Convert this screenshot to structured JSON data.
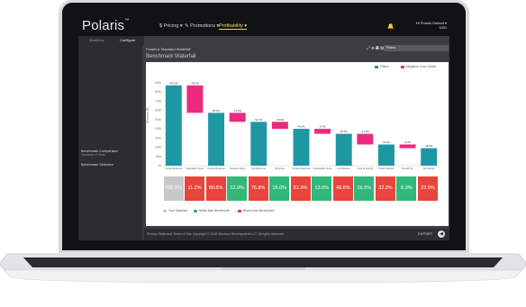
{
  "app": {
    "logo": "Polaris",
    "trademark": "™",
    "nav": [
      {
        "label": "$ Pricing ▾",
        "active": false
      },
      {
        "label": "✎ Promotions ▾",
        "active": false
      },
      {
        "label": "Profitability ▾",
        "active": true
      }
    ],
    "user": {
      "line1": "Hi Polaris Default ▾",
      "line2": "USD"
    },
    "bell_icon": "bell-icon"
  },
  "sidebar": {
    "tabs": [
      {
        "label": "Workflow",
        "active": false
      },
      {
        "label": "Configure",
        "active": true
      }
    ],
    "items": [
      {
        "label": "Benchmark Comparison",
        "sub": "Customer of Store"
      },
      {
        "label": "Benchmark Selection",
        "sub": ""
      }
    ]
  },
  "main": {
    "breadcrumb": "Polaris ▸ Standard Waterfall",
    "tools": "⤢ ⊕ ▦ ✪",
    "filter": "Filters",
    "panel_title": "Benchmark Waterfall"
  },
  "chart_data": {
    "type": "bar",
    "title": "",
    "legend": [
      {
        "label": "Filters",
        "color": "#1e97a3"
      },
      {
        "label": "Negative Cost Center",
        "color": "#ea2b80"
      }
    ],
    "ylabel": "Revenue ($)",
    "yticks": [
      "900k",
      "800k",
      "700k",
      "600k",
      "500k",
      "400k",
      "300k",
      "200k",
      "100k",
      "0k"
    ],
    "ylim": [
      0,
      900
    ],
    "categories": [
      "Gross Revenue",
      "Negotiable Items",
      "Invoice Revenue",
      "Invoiced Items",
      "Net Revenue",
      "Bonuses",
      "Pocket Revenue",
      "Chargeable Items",
      "Contribution",
      "Cost of Goods",
      "Pocket Margin",
      "Overall Inc.",
      "Net Margin"
    ],
    "bars": [
      {
        "kind": "total",
        "start": 0,
        "end": 872,
        "label": "100.0%"
      },
      {
        "kind": "decrease",
        "start": 872,
        "end": 574,
        "label": "-34.2%"
      },
      {
        "kind": "total",
        "start": 0,
        "end": 574,
        "label": "65.8%"
      },
      {
        "kind": "decrease",
        "start": 574,
        "end": 476,
        "label": "-12.0%"
      },
      {
        "kind": "total",
        "start": 0,
        "end": 476,
        "label": "54.7%"
      },
      {
        "kind": "decrease",
        "start": 476,
        "end": 400,
        "label": "-15.0%"
      },
      {
        "kind": "total",
        "start": 0,
        "end": 400,
        "label": "46.0%"
      },
      {
        "kind": "decrease",
        "start": 400,
        "end": 346,
        "label": "-8.0%"
      },
      {
        "kind": "total",
        "start": 0,
        "end": 346,
        "label": "36.8%"
      },
      {
        "kind": "decrease",
        "start": 346,
        "end": 230,
        "label": "-17.0%"
      },
      {
        "kind": "total",
        "start": 0,
        "end": 230,
        "label": "23.0%"
      },
      {
        "kind": "decrease",
        "start": 230,
        "end": 190,
        "label": "-6.2%"
      },
      {
        "kind": "total",
        "start": 0,
        "end": 190,
        "label": "18.0%"
      }
    ]
  },
  "tiles": [
    {
      "label": "100.0%",
      "color": "#c8c8c8"
    },
    {
      "label": "11.2%",
      "color": "#e8453c"
    },
    {
      "label": "88.8%",
      "color": "#e8453c"
    },
    {
      "label": "12.0%",
      "color": "#33b77a"
    },
    {
      "label": "76.8%",
      "color": "#e8453c"
    },
    {
      "label": "15.0%",
      "color": "#33b77a"
    },
    {
      "label": "61.8%",
      "color": "#e8453c"
    },
    {
      "label": "13.0%",
      "color": "#33b77a"
    },
    {
      "label": "48.8%",
      "color": "#e8453c"
    },
    {
      "label": "16.5%",
      "color": "#33b77a"
    },
    {
      "label": "32.3%",
      "color": "#e8453c"
    },
    {
      "label": "8.3%",
      "color": "#33b77a"
    },
    {
      "label": "23.9%",
      "color": "#e8453c"
    }
  ],
  "tile_legend": [
    {
      "label": "Your Standard",
      "color": "#c8c8c8"
    },
    {
      "label": "Better than Benchmark",
      "color": "#33b77a"
    },
    {
      "label": "Worse than Benchmark",
      "color": "#e8453c"
    }
  ],
  "footer": {
    "text": "Privacy Statement   Terms of Use   Copyright © 2015 Vendavo Development LLC. All rights reserved.",
    "export": "EXPORT"
  }
}
